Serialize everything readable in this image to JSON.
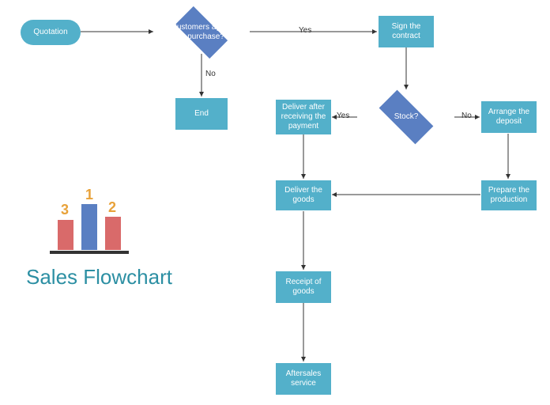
{
  "title": "Sales Flowchart",
  "nodes": {
    "quotation": "Quotation",
    "customers_agree": "Customers agree to purchase?",
    "end": "End",
    "sign_contract": "Sign the contract",
    "stock": "Stock?",
    "deliver_after_payment": "Deliver after receiving the payment",
    "arrange_deposit": "Arrange the deposit",
    "deliver_goods": "Deliver the goods",
    "prepare_production": "Prepare the production",
    "receipt_goods": "Receipt of goods",
    "aftersales": "Aftersales service"
  },
  "labels": {
    "yes1": "Yes",
    "no1": "No",
    "yes2": "Yes",
    "no2": "No"
  },
  "podium": {
    "first": "1",
    "second": "2",
    "third": "3"
  }
}
